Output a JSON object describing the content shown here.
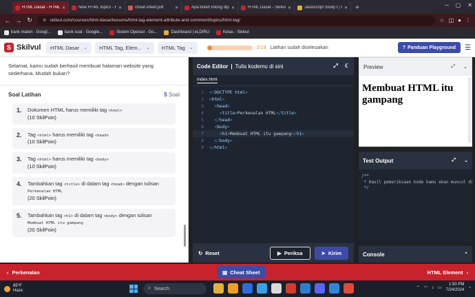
{
  "browser": {
    "tabs": [
      {
        "label": "HTML Dasar - HTML Tag",
        "active": true,
        "color": "#c8232c"
      },
      {
        "label": "New HTML topics - Forum",
        "active": false,
        "color": "#c8232c"
      },
      {
        "label": "cheat-sheet.pdf",
        "active": false,
        "color": "#d9534f"
      },
      {
        "label": "Apa boleh tolong dipenin",
        "active": false,
        "color": "#c8232c"
      },
      {
        "label": "HTML Dasar - Skilvul",
        "active": false,
        "color": "#c8232c"
      },
      {
        "label": "JavaScript Study I | Progat",
        "active": false,
        "color": "#e0b23a"
      }
    ],
    "url": "skilvul.com/courses/html-dasar/lessons/html-tag-element-attribute-and-comment/topics/html-tag/",
    "bookmarks": [
      {
        "label": "bank materi - Googl...",
        "color": "#e8e8e8"
      },
      {
        "label": "bank soal - Google...",
        "color": "#e8e8e8"
      },
      {
        "label": "Sistem Operasi - Go...",
        "color": "#c8232c"
      },
      {
        "label": "Dashboard | eLDIRU",
        "color": "#e0b23a"
      },
      {
        "label": "Kelas - Skilvul",
        "color": "#c8232c"
      }
    ]
  },
  "header": {
    "brand": "Skilvul",
    "breadcrumbs": [
      "HTML Dasar",
      "HTML Tag, Elem...",
      "HTML Tag"
    ],
    "progress_count": "2/19",
    "progress_fraction": 0.105,
    "progress_label": "Latihan sudah diselesaikan",
    "playground_button": "Panduan Playground"
  },
  "left": {
    "intro": "Selamat, kamu sudah berhasil membuat halaman website yang sederhana. Mudah bukan?",
    "soal_title": "Soal Latihan",
    "soal_count": "5",
    "soal_count_word": "Soal",
    "questions": [
      {
        "num": "1.",
        "a": "Dokumen HTML harus memiliki tag ",
        "c1": "<html>",
        "b": "",
        "c2": "",
        "d": "",
        "c3": "",
        "points": "(10 SkilPoin)"
      },
      {
        "num": "2.",
        "a": "Tag ",
        "c1": "<html>",
        "b": " harus memiliki tag ",
        "c2": "<head>",
        "d": "",
        "c3": "",
        "points": "(10 SkilPoin)"
      },
      {
        "num": "3.",
        "a": "Tag ",
        "c1": "<html>",
        "b": " harus memiliki tag ",
        "c2": "<body>",
        "d": "",
        "c3": "",
        "points": "(10 SkilPoin)"
      },
      {
        "num": "4.",
        "a": "Tambahkan tag ",
        "c1": "<title>",
        "b": " di dalam tag ",
        "c2": "<head>",
        "d": " dengan tulisan ",
        "c3": "Perkenalan HTML",
        "points": "(20 SkilPoin)"
      },
      {
        "num": "5.",
        "a": "Tambahkan tag ",
        "c1": "<h1>",
        "b": " di dalam tag ",
        "c2": "<body>",
        "d": " dengan tulisan ",
        "c3": "Membuat HTML itu gampang",
        "points": "(20 SkilPoin)"
      }
    ]
  },
  "editor": {
    "title": "Code Editor",
    "subtitle": "Tulis kodemu di sini",
    "file_tab": "index.html",
    "lines": [
      {
        "n": "1",
        "code": "<!DOCTYPE html>"
      },
      {
        "n": "2",
        "code": "<html>"
      },
      {
        "n": "3",
        "code": "  <head>"
      },
      {
        "n": "4",
        "code": "    <title>Perkenalan HTML</title>"
      },
      {
        "n": "5",
        "code": "  </head>"
      },
      {
        "n": "6",
        "code": "  <body>"
      },
      {
        "n": "7",
        "code": "    <h1>Membuat HTML itu gampang</h1>"
      },
      {
        "n": "8",
        "code": "  </body>"
      },
      {
        "n": "9",
        "code": "</html>"
      }
    ],
    "reset_label": "Reset",
    "periksa_label": "Periksa",
    "kirim_label": "Kirim"
  },
  "preview": {
    "title": "Preview",
    "heading": "Membuat HTML itu gampang"
  },
  "test_output": {
    "title": "Test Output",
    "text": "/**\n * Hasil pemeriksaan kode kamu akan muncul di\n */"
  },
  "console": {
    "title": "Console"
  },
  "footer": {
    "prev_label": "Perkenalan",
    "cheat_label": "Cheat Sheet",
    "next_label": "HTML Element"
  },
  "taskbar": {
    "temp": "85°F",
    "weather": "Haze",
    "search_placeholder": "Search",
    "time": "1:50 PM",
    "date": "7/24/2024",
    "apps": [
      "#e0b23a",
      "#f0a020",
      "#2b6cd9",
      "#3aa0e6",
      "#d9d9d9",
      "#d33b2c",
      "#2d7dd2",
      "#5865f2",
      "#2f86d6",
      "#e04a3a"
    ]
  },
  "colors": {
    "brand": "#c8232c",
    "accent": "#3d4ba8",
    "progress": "#f08a3a"
  }
}
